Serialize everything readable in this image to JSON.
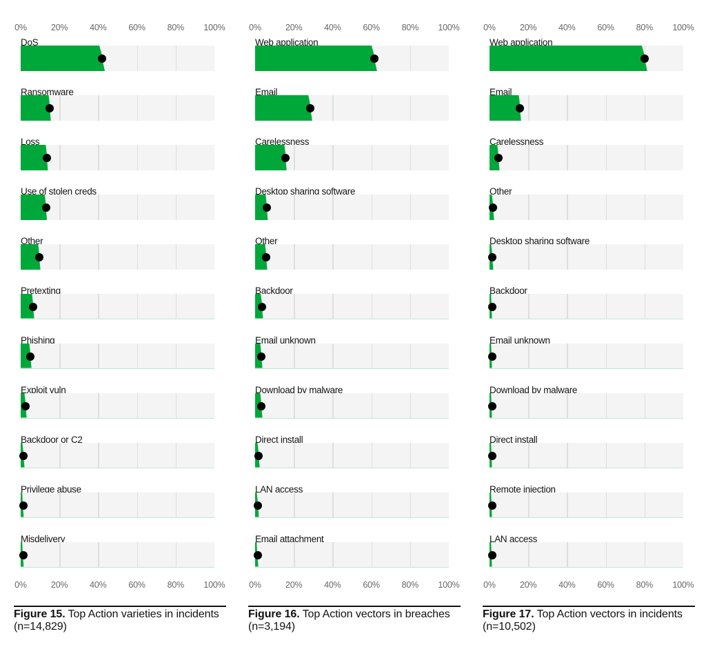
{
  "colors": {
    "bar": "#00a83a",
    "track": "#f4f4f4",
    "grid": "#dedede",
    "dot": "#000000",
    "baseline": "#bfe9d2"
  },
  "chart_data": [
    {
      "type": "bar",
      "orientation": "horizontal",
      "title": "Figure 15. Top Action varieties in incidents (n=14,829)",
      "caption_label": "Figure 15.",
      "caption_text": "Top Action varieties in incidents (n=14,829)",
      "xlim": [
        0,
        100
      ],
      "x_unit": "%",
      "ticks": [
        "0%",
        "20%",
        "40%",
        "60%",
        "80%",
        "100%"
      ],
      "grid": true,
      "categories": [
        "DoS",
        "Ransomware",
        "Loss",
        "Use of stolen creds",
        "Other",
        "Pretexting",
        "Phishing",
        "Exploit vuln",
        "Backdoor or C2",
        "Privilege abuse",
        "Misdelivery"
      ],
      "values": [
        42,
        15,
        13.5,
        13,
        9.6,
        6.4,
        5,
        2.5,
        1.4,
        1,
        1
      ]
    },
    {
      "type": "bar",
      "orientation": "horizontal",
      "title": "Figure 16. Top Action vectors in breaches (n=3,194)",
      "caption_label": "Figure 16.",
      "caption_text": "Top Action vectors in breaches (n=3,194)",
      "xlim": [
        0,
        100
      ],
      "x_unit": "%",
      "ticks": [
        "0%",
        "20%",
        "40%",
        "60%",
        "80%",
        "100%"
      ],
      "grid": true,
      "categories": [
        "Web application",
        "Email",
        "Carelessness",
        "Desktop sharing software",
        "Other",
        "Backdoor",
        "Email unknown",
        "Download by malware",
        "Direct install",
        "LAN access",
        "Email attachment"
      ],
      "values": [
        61.5,
        28.5,
        15.7,
        6,
        5.7,
        3.5,
        3.2,
        3.2,
        1.8,
        1.4,
        1.1
      ]
    },
    {
      "type": "bar",
      "orientation": "horizontal",
      "title": "Figure 17. Top Action vectors in incidents (n=10,502)",
      "caption_label": "Figure 17.",
      "caption_text": "Top Action vectors in incidents (n=10,502)",
      "xlim": [
        0,
        100
      ],
      "x_unit": "%",
      "ticks": [
        "0%",
        "20%",
        "40%",
        "60%",
        "80%",
        "100%"
      ],
      "grid": true,
      "categories": [
        "Web application",
        "Email",
        "Carelessness",
        "Other",
        "Desktop sharing software",
        "Backdoor",
        "Email unknown",
        "Download by malware",
        "Direct install",
        "Remote injection",
        "LAN access"
      ],
      "values": [
        80,
        15.7,
        4.6,
        1.8,
        1.4,
        0.7,
        0.6,
        0.6,
        0.5,
        0.5,
        0.5
      ]
    }
  ]
}
